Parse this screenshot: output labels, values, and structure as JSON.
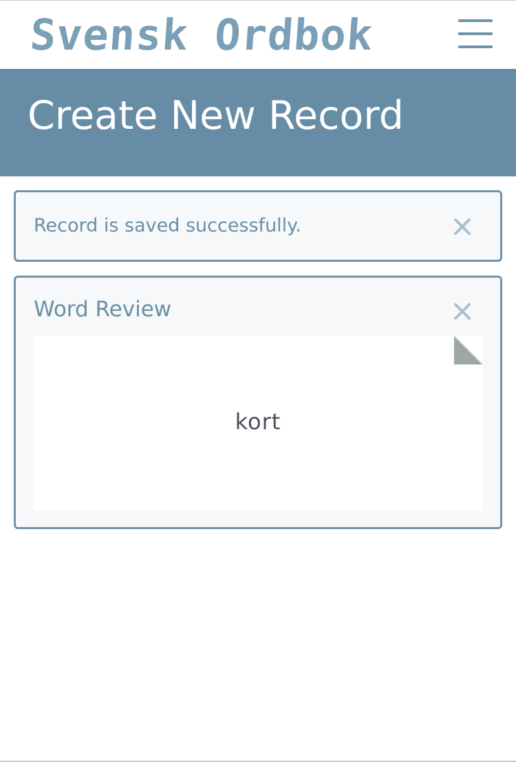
{
  "header": {
    "logo_text": "Svensk Ordbok",
    "menu_icon": "hamburger-menu-icon"
  },
  "page": {
    "title": "Create New Record"
  },
  "alert": {
    "message": "Record is saved successfully.",
    "close_icon": "close-icon"
  },
  "review": {
    "title": "Word Review",
    "close_icon": "close-icon",
    "word": "kort",
    "flip_icon": "page-curl-icon"
  },
  "colors": {
    "accent": "#678ca6",
    "logo": "#7a9fb6",
    "panel_border": "#6f93aa",
    "panel_bg": "#f6f8fa",
    "text_muted": "#6a8fa6",
    "word_text": "#4a4f5a"
  }
}
